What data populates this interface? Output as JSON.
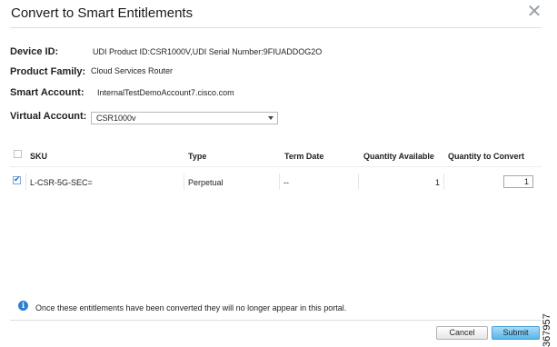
{
  "dialog": {
    "title": "Convert to Smart Entitlements",
    "close_icon": "close-x-icon"
  },
  "fields": {
    "device_id_label": "Device ID:",
    "device_id_value": "UDI Product ID:CSR1000V,UDI Serial Number:9FIUADDOG2O",
    "product_family_label": "Product Family:",
    "product_family_value": "Cloud Services Router",
    "smart_account_label": "Smart Account:",
    "smart_account_value": "InternalTestDemoAccount7.cisco.com",
    "virtual_account_label": "Virtual Account:",
    "virtual_account_value": "CSR1000v"
  },
  "table": {
    "headers": {
      "sku": "SKU",
      "type": "Type",
      "term_date": "Term Date",
      "quantity_available": "Quantity Available",
      "quantity_to_convert": "Quantity to Convert"
    },
    "rows": [
      {
        "checked": true,
        "sku": "L-CSR-5G-SEC=",
        "type": "Perpetual",
        "term_date": "--",
        "quantity_available": "1",
        "quantity_to_convert": "1"
      }
    ]
  },
  "footer": {
    "info_icon": "info-icon",
    "info_text": "Once these entitlements have been converted they will no longer appear in this portal.",
    "cancel_label": "Cancel",
    "submit_label": "Submit"
  },
  "figure_id": "367957",
  "colors": {
    "accent_blue": "#2d7fd3",
    "submit_button": "#59b6e8",
    "divider": "#dedede"
  }
}
